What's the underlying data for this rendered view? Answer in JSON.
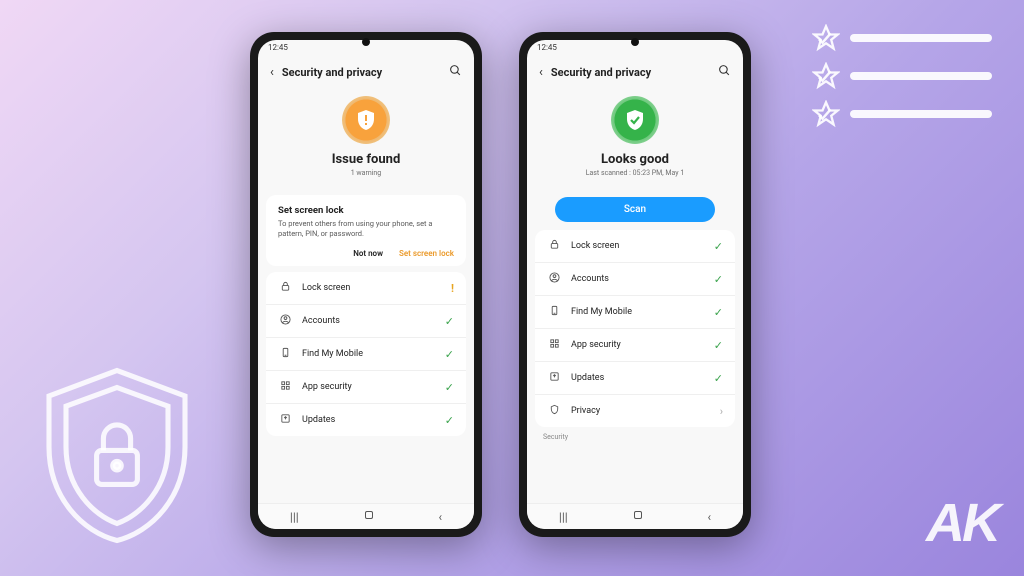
{
  "status_time": "12:45",
  "header": {
    "title": "Security and privacy"
  },
  "phone_left": {
    "status": {
      "title": "Issue found",
      "sub": "1 warning"
    },
    "card": {
      "title": "Set screen lock",
      "desc": "To prevent others from using your phone, set a pattern, PIN, or password.",
      "not_now": "Not now",
      "action": "Set screen lock"
    },
    "rows": [
      {
        "icon": "lock",
        "label": "Lock screen",
        "trail": "warn"
      },
      {
        "icon": "user",
        "label": "Accounts",
        "trail": "check"
      },
      {
        "icon": "phone",
        "label": "Find My Mobile",
        "trail": "check"
      },
      {
        "icon": "grid",
        "label": "App security",
        "trail": "check"
      },
      {
        "icon": "arrow",
        "label": "Updates",
        "trail": "check"
      }
    ]
  },
  "phone_right": {
    "status": {
      "title": "Looks good",
      "sub": "Last scanned : 05:23 PM, May 1"
    },
    "scan_label": "Scan",
    "rows": [
      {
        "icon": "lock",
        "label": "Lock screen",
        "trail": "check"
      },
      {
        "icon": "user",
        "label": "Accounts",
        "trail": "check"
      },
      {
        "icon": "phone",
        "label": "Find My Mobile",
        "trail": "check"
      },
      {
        "icon": "grid",
        "label": "App security",
        "trail": "check"
      },
      {
        "icon": "arrow",
        "label": "Updates",
        "trail": "check"
      },
      {
        "icon": "shield",
        "label": "Privacy",
        "trail": "chev"
      }
    ],
    "section": "Security"
  },
  "logo": "AK"
}
